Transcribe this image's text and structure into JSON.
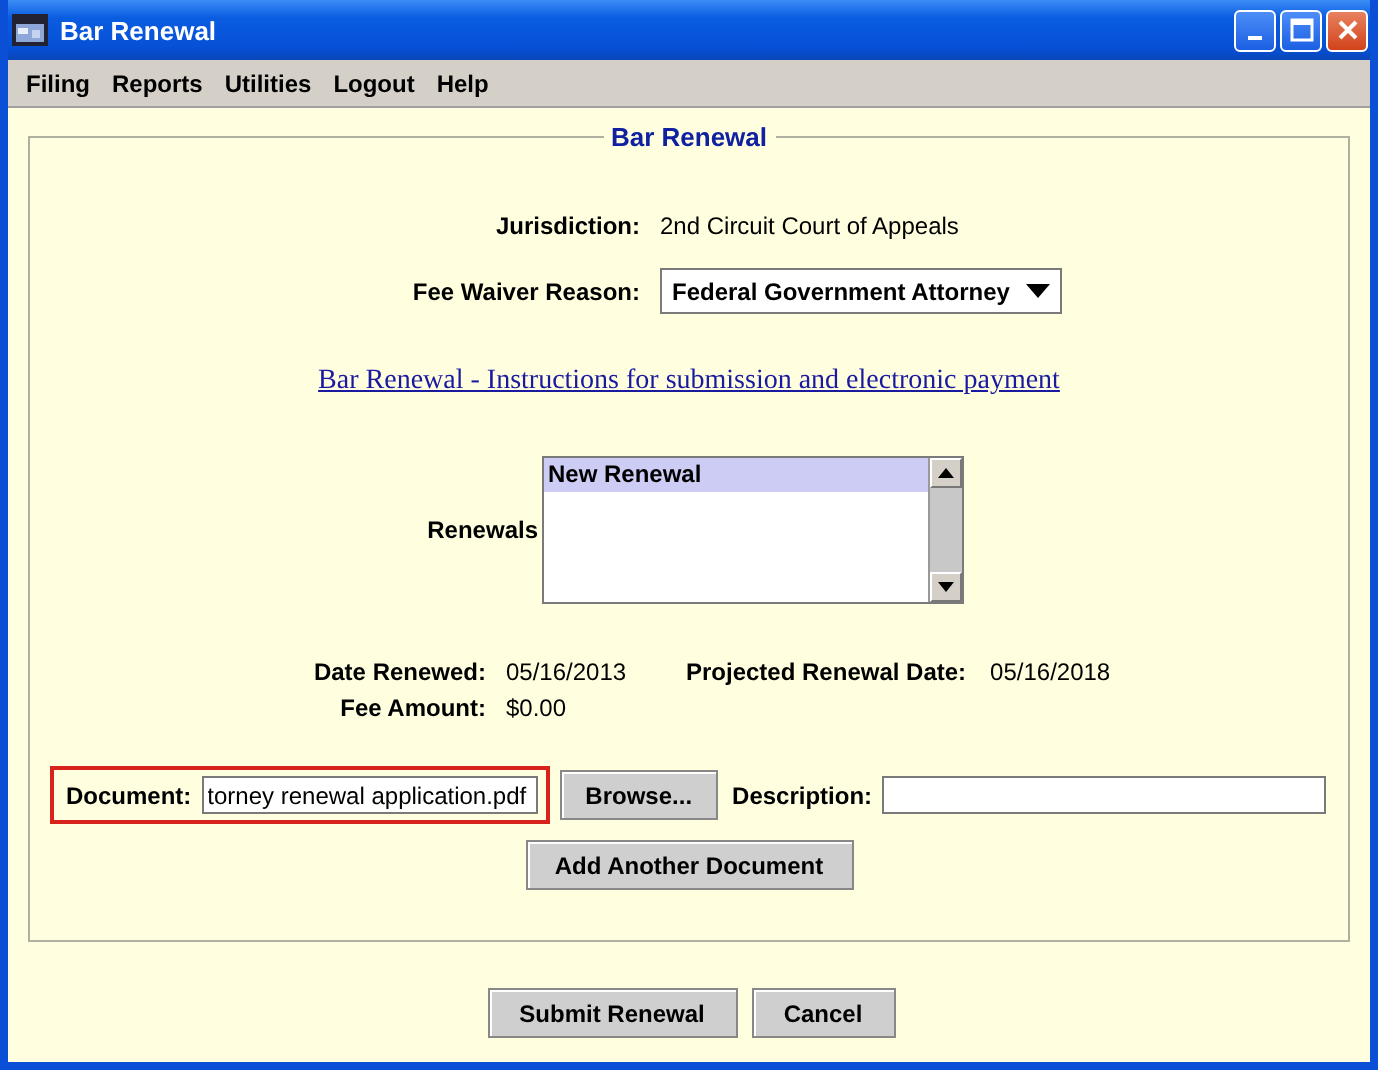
{
  "window": {
    "title": "Bar Renewal"
  },
  "menu": [
    "Filing",
    "Reports",
    "Utilities",
    "Logout",
    "Help"
  ],
  "section_title": "Bar Renewal",
  "jurisdiction": {
    "label": "Jurisdiction:",
    "value": "2nd Circuit Court of Appeals"
  },
  "fee_waiver": {
    "label": "Fee Waiver Reason:",
    "value": "Federal Government Attorney"
  },
  "instructions_link": "Bar Renewal - Instructions for submission and electronic payment",
  "renewals": {
    "label": "Renewals",
    "items": [
      {
        "text": "New Renewal",
        "selected": true
      }
    ]
  },
  "date_renewed": {
    "label": "Date Renewed:",
    "value": "05/16/2013"
  },
  "projected_renewal_date": {
    "label": "Projected Renewal Date:",
    "value": "05/16/2018"
  },
  "fee_amount": {
    "label": "Fee Amount:",
    "value": "$0.00"
  },
  "document": {
    "label": "Document:",
    "value": "torney renewal application.pdf",
    "highlighted": true
  },
  "browse_button": "Browse...",
  "description": {
    "label": "Description:"
  },
  "add_document_button": "Add Another Document",
  "buttons": [
    "Submit Renewal",
    "Cancel"
  ]
}
